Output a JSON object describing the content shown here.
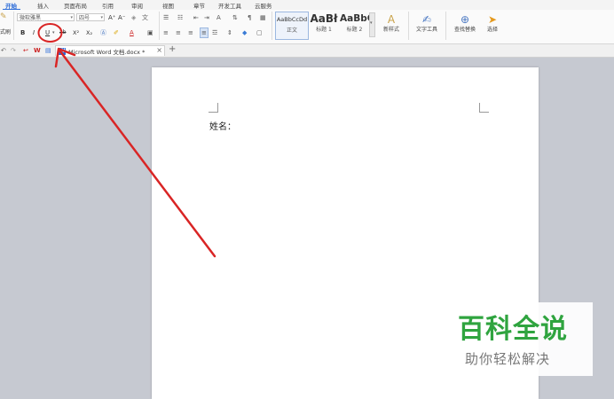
{
  "menu": {
    "tabs": [
      "开始",
      "插入",
      "页面布局",
      "引用",
      "审阅",
      "视图",
      "章节",
      "开发工具",
      "云服务"
    ],
    "active_tab": "开始"
  },
  "ribbon": {
    "format_painter_label": "式刷",
    "font_name": "微软雅黑",
    "font_size": "四号",
    "bold": "B",
    "italic": "I",
    "underline": "U",
    "strikethrough": "ab",
    "superscript": "X²",
    "subscript": "X₂",
    "grow_font": "A⁺",
    "shrink_font": "A⁻",
    "font_color": "A",
    "styles": [
      {
        "preview": "AaBbCcDd",
        "label": "正文"
      },
      {
        "preview": "AaBł",
        "label": "标题 1"
      },
      {
        "preview": "AaBbC",
        "label": "标题 2"
      }
    ],
    "new_style_label": "新样式",
    "text_tools_label": "文字工具",
    "find_replace_label": "查找替换",
    "select_label": "选择"
  },
  "tabbar": {
    "doc_title": "Microsoft Word 文档.docx *",
    "close_symbol": "×",
    "add_symbol": "+"
  },
  "document": {
    "line1": "姓名："
  },
  "watermark": {
    "title": "百科全说",
    "subtitle": "助你轻松解决"
  },
  "colors": {
    "accent": "#2b6bd8",
    "annotation": "#d92525",
    "watermark_green": "#2fa43f"
  }
}
